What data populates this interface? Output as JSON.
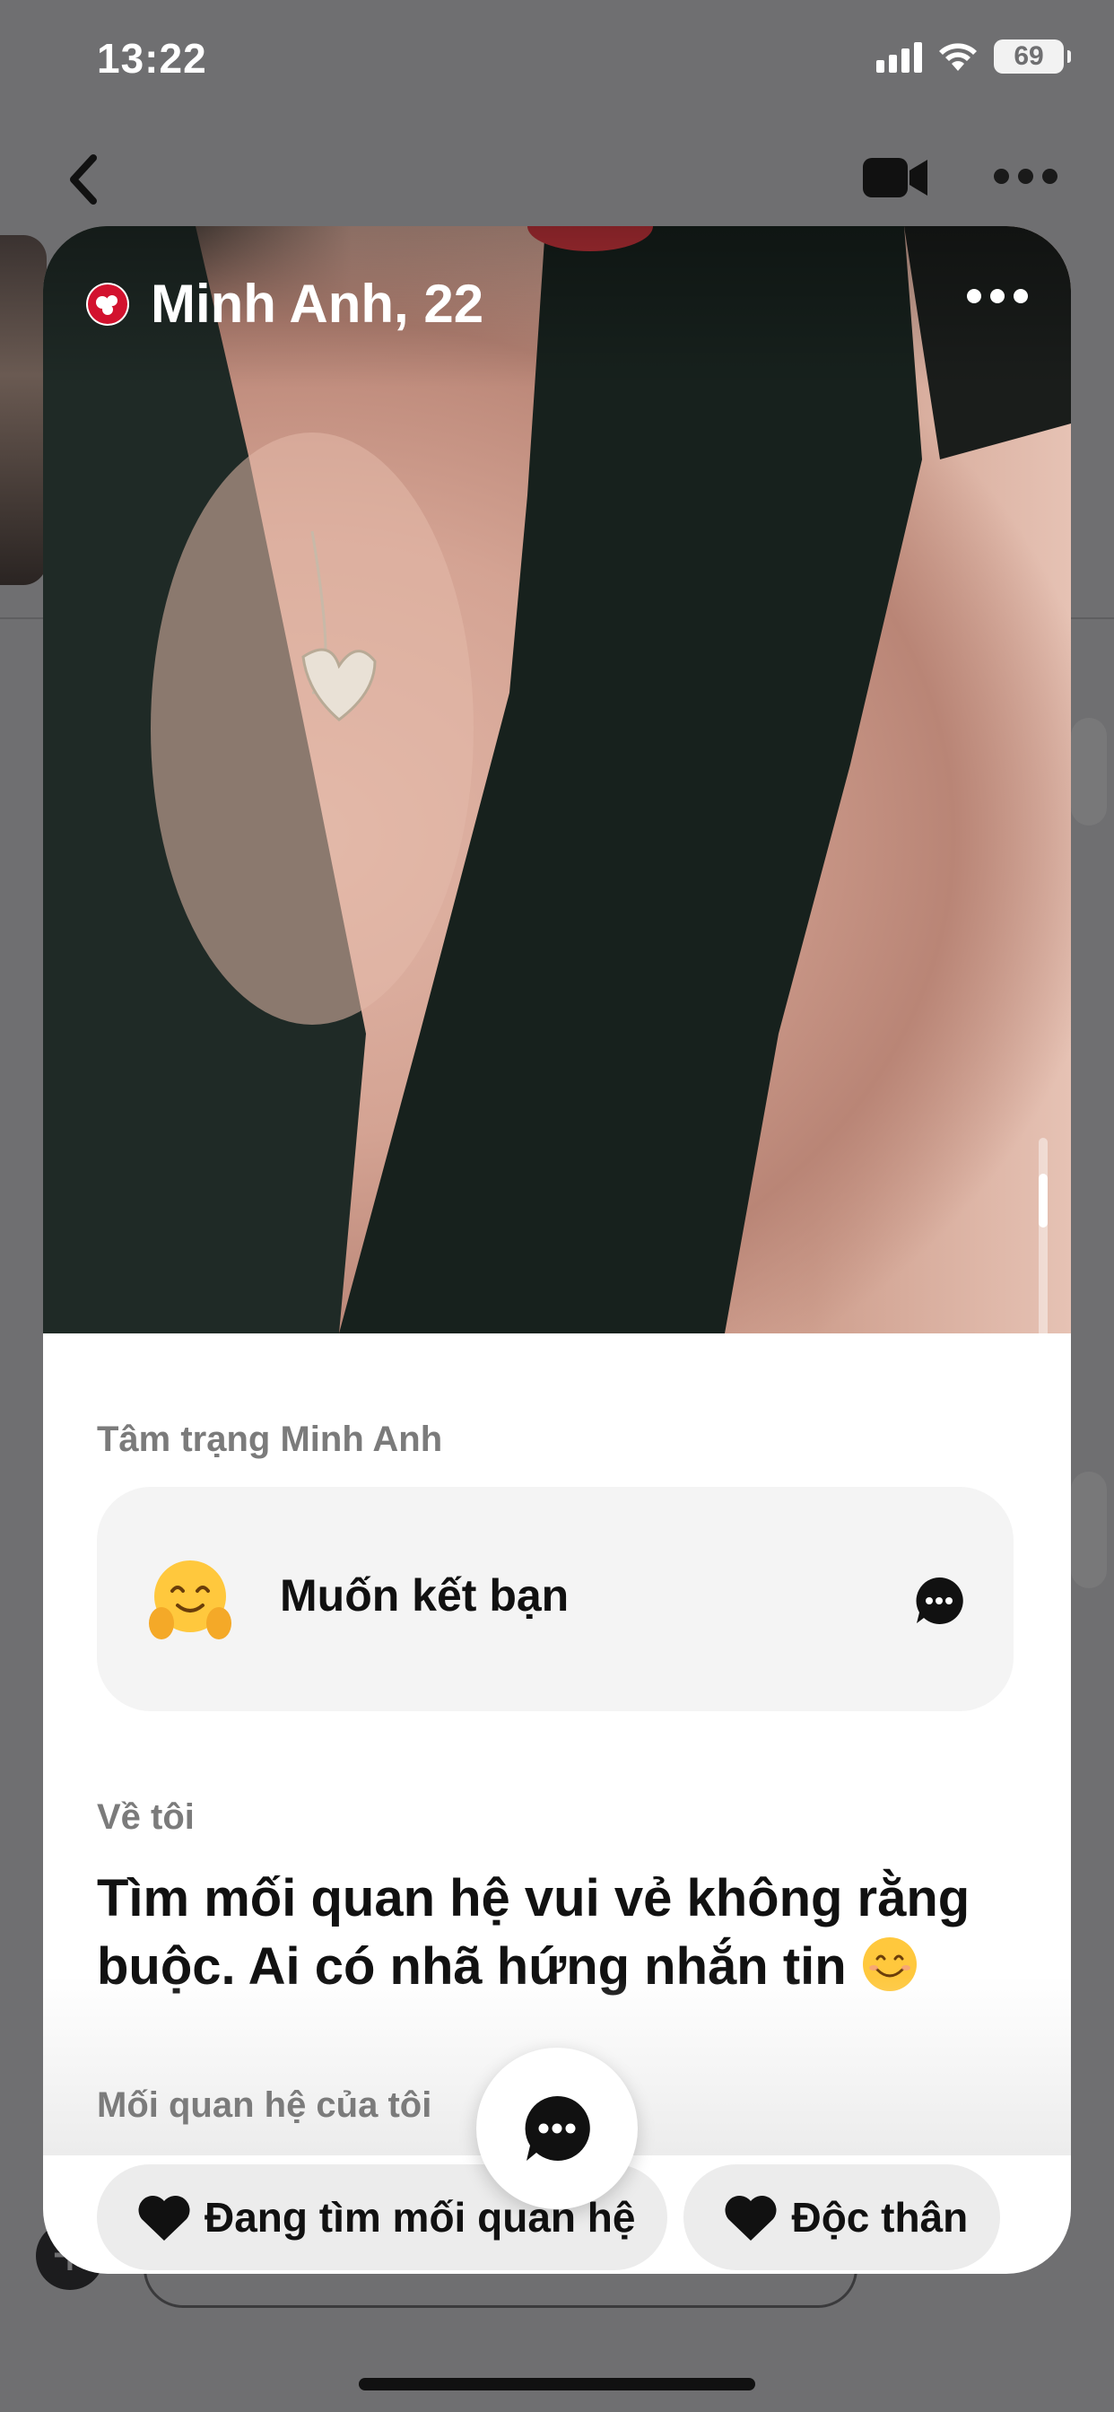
{
  "status_bar": {
    "time": "13:22",
    "battery": "69"
  },
  "profile": {
    "name_age": "Minh Anh, 22",
    "mood_label": "Tâm trạng Minh Anh",
    "mood_text": "Muốn kết bạn",
    "about_label": "Về tôi",
    "about_text": "Tìm mối quan hệ vui vẻ không rằng buộc. Ai có nhã hứng nhắn tin",
    "relationship_label": "Mối quan hệ của tôi",
    "relationship_chips": [
      "Đang tìm mối quan hệ",
      "Độc thân"
    ]
  },
  "icons": {
    "back": "chevron-left-icon",
    "video": "video-camera-icon",
    "more": "more-dots-icon",
    "chat": "chat-bubble-icon",
    "mood_emoji": "hugging-face-emoji",
    "about_emoji": "smiling-face-emoji",
    "chip": "heart-icon"
  },
  "colors": {
    "brand": "#d2122e",
    "overlay": "#6f6f71",
    "chip_bg": "#ececec"
  }
}
